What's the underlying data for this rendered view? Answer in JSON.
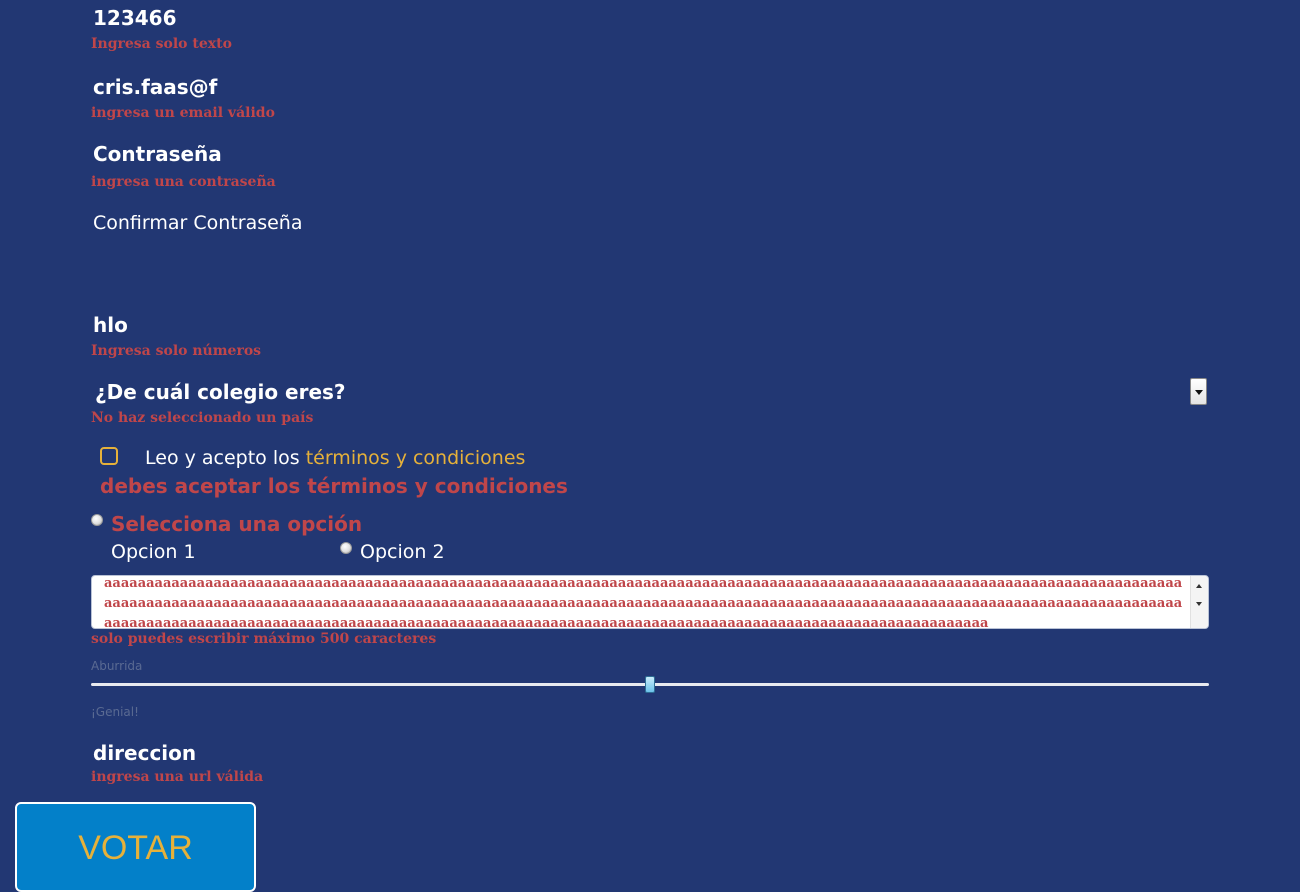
{
  "form": {
    "name_value": "123466",
    "name_error": "Ingresa solo texto",
    "email_value": "cris.faas@f",
    "email_error": "ingresa un email válido",
    "password_label": "Contraseña",
    "password_error": "ingresa una contraseña",
    "confirm_password_label": "Confirmar Contraseña",
    "number_value": "hlo",
    "number_error": "Ingresa solo números",
    "school_select_value": "¿De cuál colegio eres?",
    "school_error": "No haz seleccionado un país",
    "terms_prefix": "Leo y acepto los ",
    "terms_link": "términos y condiciones",
    "terms_checked": false,
    "terms_error": "debes aceptar los términos y condiciones",
    "radio_error": "Selecciona una opción",
    "option1_label": "Opcion 1",
    "option2_label": "Opcion 2",
    "textarea_value": "aaaaaaaaaaaaaaaaaaaaaaaaaaaaaaaaaaaaaaaaaaaaaaaaaaaaaaaaaaaaaaaaaaaaaaaaaaaaaaaaaaaaaaaaaaaaaaaaaaaaaaaaaaaaaaaaaaaaaaaaaaaaaaaaaaaaaaaaaaaaaaaaaaaaaaaaaaaaaaaaaaaaaaaaaaaaaaaaaaaaaaaaaaaaaaaaaaaaaaaaaaaaaaaaaaaaaaaaaaaaaaaaaaaaaaaaaaaaaaaaaaaaaaaaaaaaaaaaaaaaaaaaaaaaaaaaaaaaaaaaaaaaaaaaaaaaaaaaaaaaaaaaaaaaaaaaaaaaaaaaaaaaaaaaaaaaaaaaaaaaaaaaaaaaaaaaaaaaaaaaa",
    "textarea_error": "solo puedes escribir máximo 500 caracteres",
    "range_min_label": "Aburrida",
    "range_max_label": "¡Genial!",
    "range_value_percent": 50,
    "url_value": "direccion",
    "url_error": "ingresa una url válida",
    "submit_label": "VOTAR"
  },
  "colors": {
    "background": "#223773",
    "error": "#c0464a",
    "accent": "#e6b13a",
    "button": "#0380c9"
  }
}
